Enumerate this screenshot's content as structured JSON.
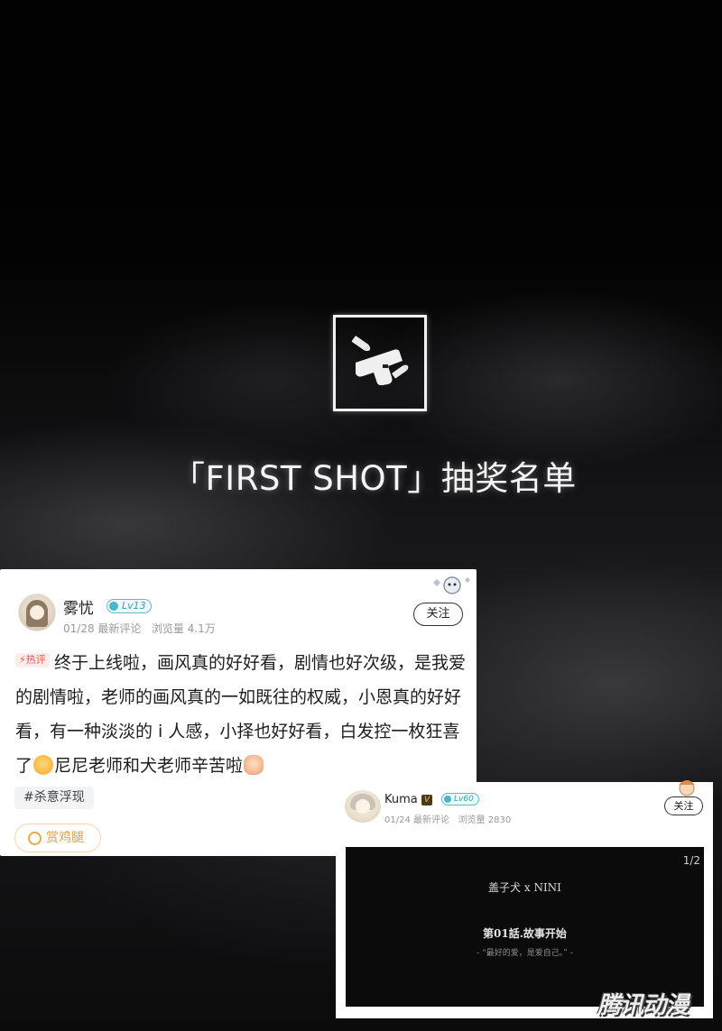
{
  "headline": "「FIRST SHOT」抽奖名单",
  "post1": {
    "username": "雾忧",
    "level": "Lv13",
    "date": "01/28",
    "date_label": "最新评论",
    "views": "浏览量 4.1万",
    "follow_label": "关注",
    "hot_label": "热评",
    "text_part1": "终于上线啦，画风真的好好看，剧情也好次级，是我爱的剧情啦，老师的画风真的一如既往的权威，小恩真的好好看，有一种淡淡的 i 人感，小择也好好看，白发控一枚狂喜了",
    "text_part2": "尼尼老师和犬老师辛苦啦",
    "topic_tag": "#杀意浮现",
    "reward_label": "赏鸡腿"
  },
  "post2": {
    "username": "Kuma",
    "vip": "V",
    "level": "Lv60",
    "date": "01/24",
    "date_label": "最新评论",
    "views": "浏览量 2830",
    "follow_label": "关注",
    "page_indicator": "1/2",
    "video_title": "盖子犬 x NINI",
    "video_episode": "第01話.故事开始",
    "video_quote": "- “最好的爱，是爱自己。” -"
  },
  "watermark": "腾讯动漫",
  "colors": {
    "accent_level": "#3aa0b5",
    "hot": "#e2574c",
    "reward": "#e0a040",
    "pager_active": "#e8604c",
    "pager_inactive": "#d0d0d0"
  },
  "icons": [
    "gun-logo-icon",
    "level-icon",
    "flame-icon",
    "drumstick-icon",
    "emoji-icon"
  ]
}
